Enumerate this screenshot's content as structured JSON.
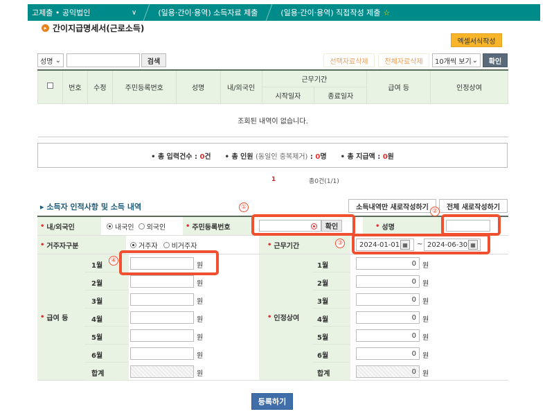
{
  "topbar": {
    "seg1": "고제출 • 공익법인",
    "seg2": "(일용·간이·용역) 소득자료 제출",
    "seg3": "(일용·간이·용역) 직접작성 제출"
  },
  "page_title": "간이지급명세서(근로소득)",
  "excel_button": "엑셀서식작성",
  "search": {
    "field_select": "성명",
    "input_value": "",
    "search_button": "검색",
    "delete_selected": "선택자료삭제",
    "delete_all": "전체자료삭제",
    "page_size": "10개씩 보기",
    "confirm_button": "확인"
  },
  "grid": {
    "headers": {
      "no": "번호",
      "edit": "수정",
      "resident_no": "주민등록번호",
      "name": "성명",
      "nationality": "내/외국인",
      "work_period": "근무기간",
      "start_date": "시작일자",
      "end_date": "종료일자",
      "salary": "급여 등",
      "bonus": "인정상여"
    },
    "empty_message": "조회된 내역이 없습니다."
  },
  "summary": {
    "input_label": "• 총 입력건수 : ",
    "input_count": "0",
    "input_unit": "건",
    "people_label": "• 총 인원 ",
    "people_note": "(동일인 중복제거)",
    "people_colon": " : ",
    "people_count": "0",
    "people_unit": "명",
    "paid_label": "• 총 지급액 : ",
    "paid_amount": "0",
    "paid_unit": "원"
  },
  "pager": {
    "current": "1",
    "total": "총0건(1/1)"
  },
  "section": {
    "title": "소득자 인적사항 및 소득 내역",
    "new_income_only": "소득내역만 새로작성하기",
    "new_all": "전체 새로작성하기"
  },
  "form": {
    "nationality_label": "내/외국인",
    "nationality_domestic": "내국인",
    "nationality_foreign": "외국인",
    "resident_no_label": "주민등록번호",
    "resident_confirm": "확인",
    "name_label": "성명",
    "residency_label": "거주자구분",
    "resident": "거주자",
    "non_resident": "비거주자",
    "work_period_label": "근무기간",
    "start_date": "2024-01-01",
    "tilde": "~",
    "end_date": "2024-06-30",
    "salary_label": "급여 등",
    "bonus_label": "인정상여",
    "unit": "원",
    "months": [
      "1월",
      "2월",
      "3월",
      "4월",
      "5월",
      "6월",
      "합계"
    ],
    "salary_values": [
      "",
      "",
      "",
      "",
      "",
      "",
      ""
    ],
    "bonus_values": [
      "0",
      "0",
      "0",
      "0",
      "0",
      "0",
      "0"
    ]
  },
  "annotations": [
    "①",
    "②",
    "③",
    "④"
  ],
  "submit_button": "등록하기",
  "colors": {
    "topbar": "#008b8b",
    "header_bg": "#e8f3e3",
    "highlight": "#f05030",
    "accent_red": "#e03030",
    "submit": "#3f6ea8",
    "excel": "#f8b52a"
  }
}
